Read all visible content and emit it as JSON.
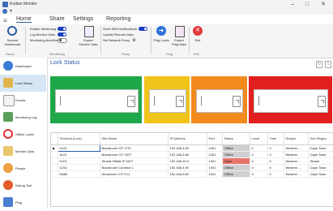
{
  "window": {
    "title": "Kodian Monitor"
  },
  "tabs": [
    "Home",
    "Share",
    "Settings",
    "Reporting"
  ],
  "ribbon": {
    "second_dashboard": "Second Dashboard",
    "monitoring_toggles": [
      "Enable Monitoring",
      "Log Monitor Data",
      "Monitoring AutoStart"
    ],
    "export_monitor": "Export Monitor Data",
    "proxy_items": [
      "Send SMS Notifications",
      "Update Remote Data",
      "Set Network Proxy"
    ],
    "ping_locks": "Ping Locks",
    "export_ping": "Export Ping Data",
    "exit": "Exit",
    "groups": [
      "Home",
      "Monitoring",
      "Proxy",
      "Ping",
      "Exit"
    ]
  },
  "sidenav": {
    "items": [
      "Dashboard",
      "Lock Status",
      "Events",
      "Monitoring Log",
      "Offline Locks",
      "Monitor Data",
      "People",
      "Debug Tool",
      "Ping"
    ]
  },
  "main": {
    "title": "Lock Status"
  },
  "tile_colors": [
    "#1ea84a",
    "#f0c419",
    "#f28a1e",
    "#e21f1f"
  ],
  "grid": {
    "columns": [
      "",
      "Terminal (Lock)",
      "Site Name",
      "IP Address",
      "Port",
      "Status",
      "Level",
      "Time",
      "Region",
      "Sub Region"
    ],
    "rows": [
      [
        "▶",
        "K121",
        "Boardroom CIT OTC",
        "192.168.4.85",
        "1001",
        "Offline",
        "0",
        "0",
        "Western ...",
        "Cape Town"
      ],
      [
        "",
        "A121",
        "Boardroom CIT NOT",
        "192.168.4.86",
        "1001",
        "Offline",
        "0",
        "0",
        "Western ...",
        "Cape Town"
      ],
      [
        "",
        "K101",
        "Strand Offsite IP NOT",
        "192.168.10.9",
        "1001",
        "Open",
        "0",
        "0",
        "Western ...",
        "Strand"
      ],
      [
        "",
        "C201",
        "Boardroom Connect 1",
        "192.168.4.90",
        "1001",
        "Offline",
        "0",
        "0",
        "Western ...",
        "Cape Town"
      ],
      [
        "",
        "D680",
        "Showroom CIT ICO",
        "192.168.4.80",
        "1001",
        "Offline",
        "0",
        "0",
        "Western ...",
        "Cape Town"
      ]
    ]
  }
}
